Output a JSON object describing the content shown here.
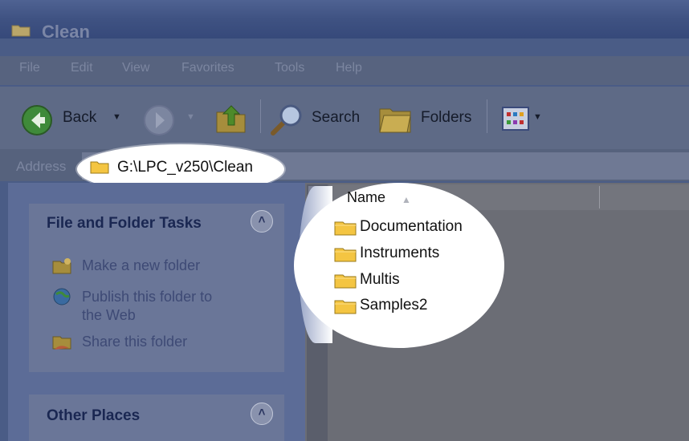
{
  "window": {
    "title": "Clean"
  },
  "menu": [
    "File",
    "Edit",
    "View",
    "Favorites",
    "Tools",
    "Help"
  ],
  "toolbar": {
    "back_label": "Back",
    "search_label": "Search",
    "folders_label": "Folders"
  },
  "address": {
    "label": "Address",
    "path": "G:\\LPC_v250\\Clean"
  },
  "tasks": {
    "file_folder_header": "File and Folder Tasks",
    "items": [
      {
        "label": "Make a new folder"
      },
      {
        "label": "Publish this folder to"
      },
      {
        "label": "the Web"
      },
      {
        "label": "Share this folder"
      }
    ],
    "other_places_header": "Other Places"
  },
  "filelist": {
    "column_name": "Name",
    "items": [
      {
        "name": "Documentation"
      },
      {
        "name": "Instruments"
      },
      {
        "name": "Multis"
      },
      {
        "name": "Samples2"
      }
    ]
  },
  "colors": {
    "folder_yellow": "#f4c542",
    "highlight_white": "#ffffff",
    "dimmed_blue": "#4a5c86"
  }
}
